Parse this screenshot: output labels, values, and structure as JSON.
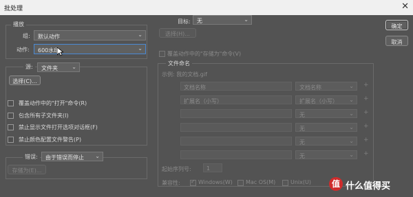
{
  "window": {
    "title": "批处理",
    "close_glyph": "✕"
  },
  "play": {
    "legend": "播放",
    "set_label": "组:",
    "set_value": "默认动作",
    "action_label": "动作:",
    "action_value": "600水印"
  },
  "source": {
    "label": "源:",
    "value": "文件夹",
    "choose_button": "选择(C)...",
    "options": [
      "覆盖动作中的\"打开\"命令(R)",
      "包含所有子文件夹(I)",
      "禁止显示文件打开选项对话框(F)",
      "禁止颜色配置文件警告(P)"
    ]
  },
  "errors": {
    "label": "错误:",
    "value": "由于错误而停止",
    "save_as_button": "存储为(E)..."
  },
  "destination": {
    "label": "目标:",
    "value": "无",
    "choose_button": "选择(H)...",
    "override_save": "覆盖动作中的\"存储为\"命令(V)"
  },
  "file_naming": {
    "legend": "文件命名",
    "example": "示例: 我的文档.gif",
    "rows": [
      {
        "field": "文档名称",
        "select": "文档名称"
      },
      {
        "field": "扩展名（小写）",
        "select": "扩展名（小写）"
      },
      {
        "field": "",
        "select": "无"
      },
      {
        "field": "",
        "select": "无"
      },
      {
        "field": "",
        "select": "无"
      },
      {
        "field": "",
        "select": "无"
      }
    ],
    "plus": "+",
    "serial_label": "起始序列号:",
    "serial_value": "1",
    "compat_label": "兼容性:",
    "compat": [
      "Windows(W)",
      "Mac OS(M)",
      "Unix(U)"
    ]
  },
  "buttons": {
    "ok": "确定",
    "cancel": "取消"
  },
  "watermark": {
    "badge": "值",
    "text": "什么值得买"
  }
}
